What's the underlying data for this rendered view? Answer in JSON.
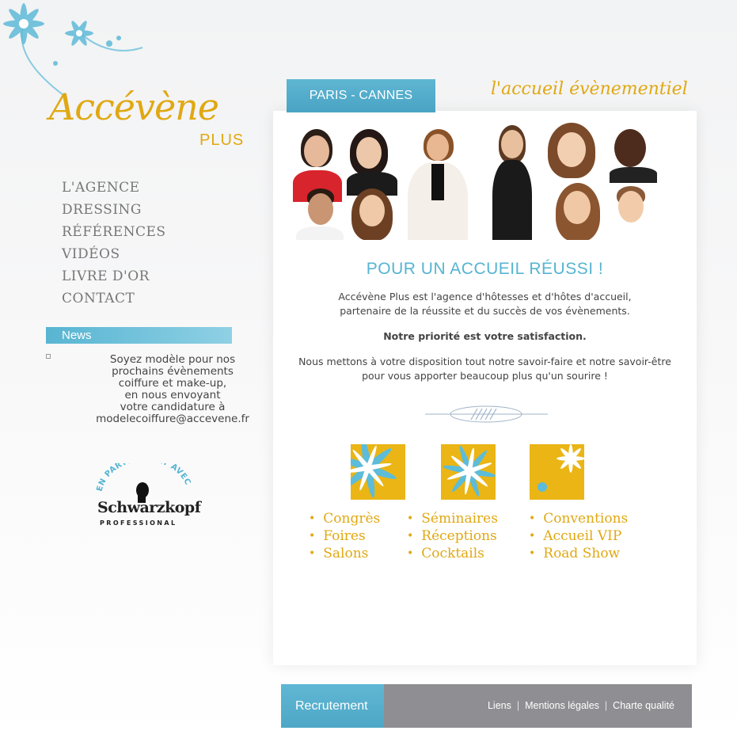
{
  "brand": {
    "logo_main": "Accévène",
    "logo_sub": "PLUS",
    "tagline": "l'accueil évènementiel",
    "accent_color": "#e0a812",
    "blue_color": "#56b4d2"
  },
  "nav": {
    "items": [
      "L'AGENCE",
      "DRESSING",
      "RÉFÉRENCES",
      "VIDÉOS",
      "LIVRE  D'OR",
      "CONTACT"
    ]
  },
  "news": {
    "title": "News",
    "lines": [
      "Soyez modèle pour nos",
      "prochains évènements",
      "coiffure et make-up,",
      "en nous envoyant",
      "votre candidature à",
      "modelecoiffure@accevene.fr"
    ]
  },
  "partner": {
    "arc_text": "EN PARTENARIAT AVEC",
    "brand": "Schwarzkopf",
    "sub": "PROFESSIONAL"
  },
  "header": {
    "city_tab": "PARIS - CANNES"
  },
  "hero": {
    "title": "POUR UN ACCUEIL RÉUSSI !",
    "intro_line1": "Accévène Plus est l'agence d'hôtesses et d'hôtes d'accueil,",
    "intro_line2": "partenaire de la réussite et du succès de vos évènements.",
    "priority": "Notre priorité est votre satisfaction.",
    "offer_line1": "Nous mettons à votre disposition tout notre savoir-faire et notre savoir-être",
    "offer_line2": "pour vous apporter beaucoup plus qu'un sourire !"
  },
  "services": {
    "col1": [
      "Congrès",
      "Foires",
      "Salons"
    ],
    "col2": [
      "Séminaires",
      "Réceptions",
      "Cocktails"
    ],
    "col3": [
      "Conventions",
      "Accueil  VIP",
      "Road  Show"
    ]
  },
  "footer": {
    "recruit": "Recrutement",
    "links": [
      "Liens",
      "Mentions légales",
      "Charte qualité"
    ]
  }
}
